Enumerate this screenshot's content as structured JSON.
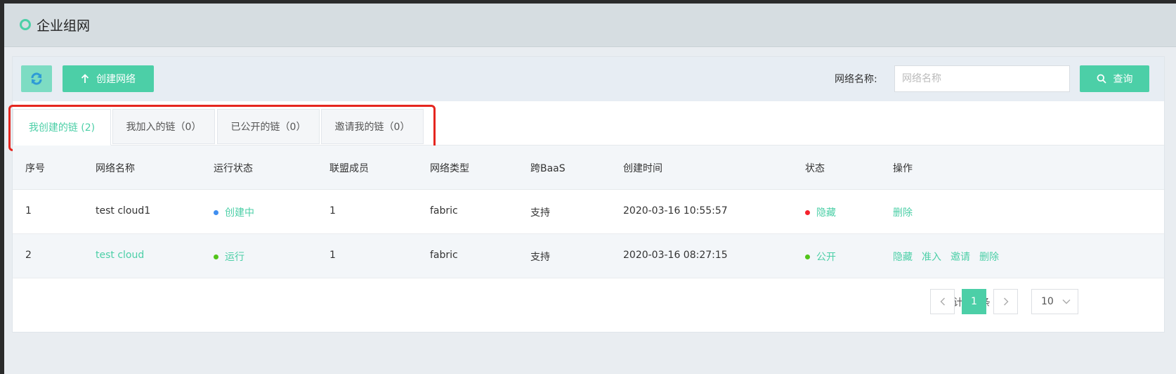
{
  "header": {
    "title": "企业组网"
  },
  "toolbar": {
    "create_label": "创建网络",
    "search_label": "网络名称:",
    "search_placeholder": "网络名称",
    "query_label": "查询"
  },
  "tabs": [
    {
      "label": "我创建的链 (2)",
      "active": true
    },
    {
      "label": "我加入的链（0）",
      "active": false
    },
    {
      "label": "已公开的链（0）",
      "active": false
    },
    {
      "label": "邀请我的链（0）",
      "active": false
    }
  ],
  "table": {
    "columns": [
      "序号",
      "网络名称",
      "运行状态",
      "联盟成员",
      "网络类型",
      "跨BaaS",
      "创建时间",
      "状态",
      "操作"
    ],
    "rows": [
      {
        "index": "1",
        "name": "test cloud1",
        "run_status": "创建中",
        "members": "1",
        "type": "fabric",
        "cross_baas": "支持",
        "created": "2020-03-16 10:55:57",
        "state": "隐藏",
        "actions": [
          "删除"
        ]
      },
      {
        "index": "2",
        "name": "test cloud",
        "run_status": "运行",
        "members": "1",
        "type": "fabric",
        "cross_baas": "支持",
        "created": "2020-03-16 08:27:15",
        "state": "公开",
        "actions": [
          "隐藏",
          "准入",
          "邀请",
          "删除"
        ]
      }
    ]
  },
  "pagination": {
    "total_prefix": "总计",
    "total": "2",
    "total_suffix": "条",
    "current_page": "1",
    "page_size": "10"
  },
  "colors": {
    "accent": "#4ccfa7",
    "highlight": "#e5261f",
    "status_blue": "#3f8ef0",
    "status_green": "#52c41a",
    "status_red": "#f5222d"
  }
}
